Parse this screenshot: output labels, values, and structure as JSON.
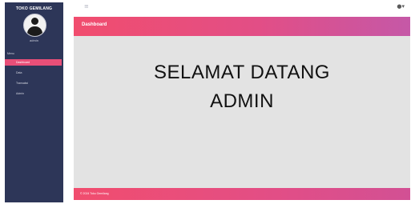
{
  "sidebar": {
    "brand": "TOKO GEMILANG",
    "username": "admin",
    "nav_title": "Menu",
    "items": [
      {
        "label": "Dashboard",
        "active": true
      },
      {
        "label": "Data"
      },
      {
        "label": "Transaksi"
      },
      {
        "label": "Admin"
      }
    ]
  },
  "topbar": {
    "menu_icon": "hamburger-icon",
    "user_icon": "user-menu-icon"
  },
  "main": {
    "header": "Dashboard",
    "welcome_line1": "SELAMAT DATANG",
    "welcome_line2": "ADMIN"
  },
  "footer": {
    "text": "© 2024 Toko Gemilang"
  },
  "colors": {
    "sidebar_bg": "#2d3658",
    "accent_pink": "#e84f78",
    "main_bg": "#e3e3e3"
  }
}
